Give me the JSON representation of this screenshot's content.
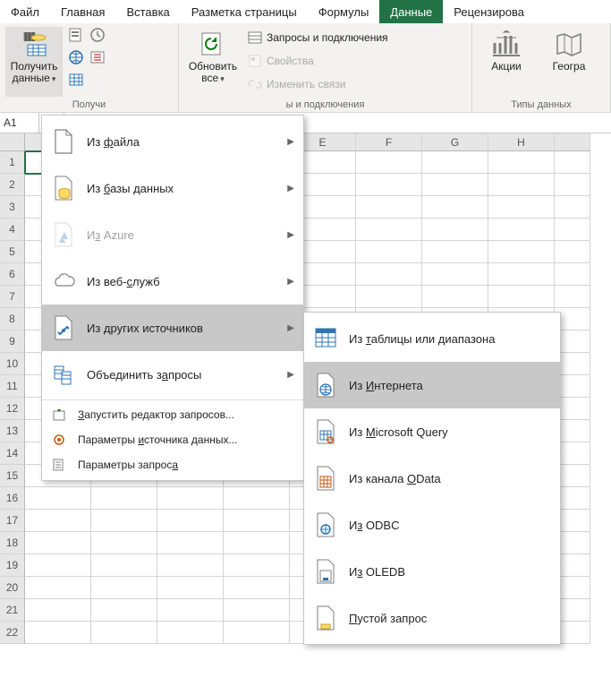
{
  "tabs": [
    "Файл",
    "Главная",
    "Вставка",
    "Разметка страницы",
    "Формулы",
    "Данные",
    "Рецензирова"
  ],
  "active_tab_index": 5,
  "ribbon": {
    "get_data": {
      "line1": "Получить",
      "line2": "данные"
    },
    "refresh": {
      "line1": "Обновить",
      "line2": "все"
    },
    "queries_conn": "Запросы и подключения",
    "properties": "Свойства",
    "edit_links": "Изменить связи",
    "stocks": "Акции",
    "geography": "Геогра",
    "group1_label": "Получи",
    "group2_label": "ы и подключения",
    "group3_label": "Типы данных"
  },
  "name_box": "A1",
  "columns": [
    "E",
    "F",
    "G",
    "H"
  ],
  "row_count": 22,
  "menu1": [
    {
      "label": "Из файла",
      "icon": "file",
      "arrow": true
    },
    {
      "label": "Из базы данных",
      "icon": "db",
      "arrow": true
    },
    {
      "label": "Из Azure",
      "icon": "azure",
      "arrow": true,
      "disabled": true
    },
    {
      "label": "Из веб-служб",
      "icon": "cloud",
      "arrow": true
    },
    {
      "label": "Из других источников",
      "icon": "other",
      "arrow": true,
      "hover": true
    },
    {
      "label": "Объединить запросы",
      "icon": "merge",
      "arrow": true
    },
    {
      "sep": true
    },
    {
      "label": "Запустить редактор запросов...",
      "icon": "launch",
      "short": true,
      "disabled": false
    },
    {
      "label": "Параметры источника данных...",
      "icon": "gear",
      "short": true
    },
    {
      "label": "Параметры запроса",
      "icon": "sheet",
      "short": true
    }
  ],
  "menu2": [
    {
      "label": "Из таблицы или диапазона",
      "icon": "table"
    },
    {
      "label": "Из Интернета",
      "icon": "web",
      "hover": true
    },
    {
      "label": "Из Microsoft Query",
      "icon": "mquery"
    },
    {
      "label": "Из канала OData",
      "icon": "odata"
    },
    {
      "label": "Из ODBC",
      "icon": "odbc"
    },
    {
      "label": "Из OLEDB",
      "icon": "oledb"
    },
    {
      "label": "Пустой запрос",
      "icon": "blank"
    }
  ]
}
